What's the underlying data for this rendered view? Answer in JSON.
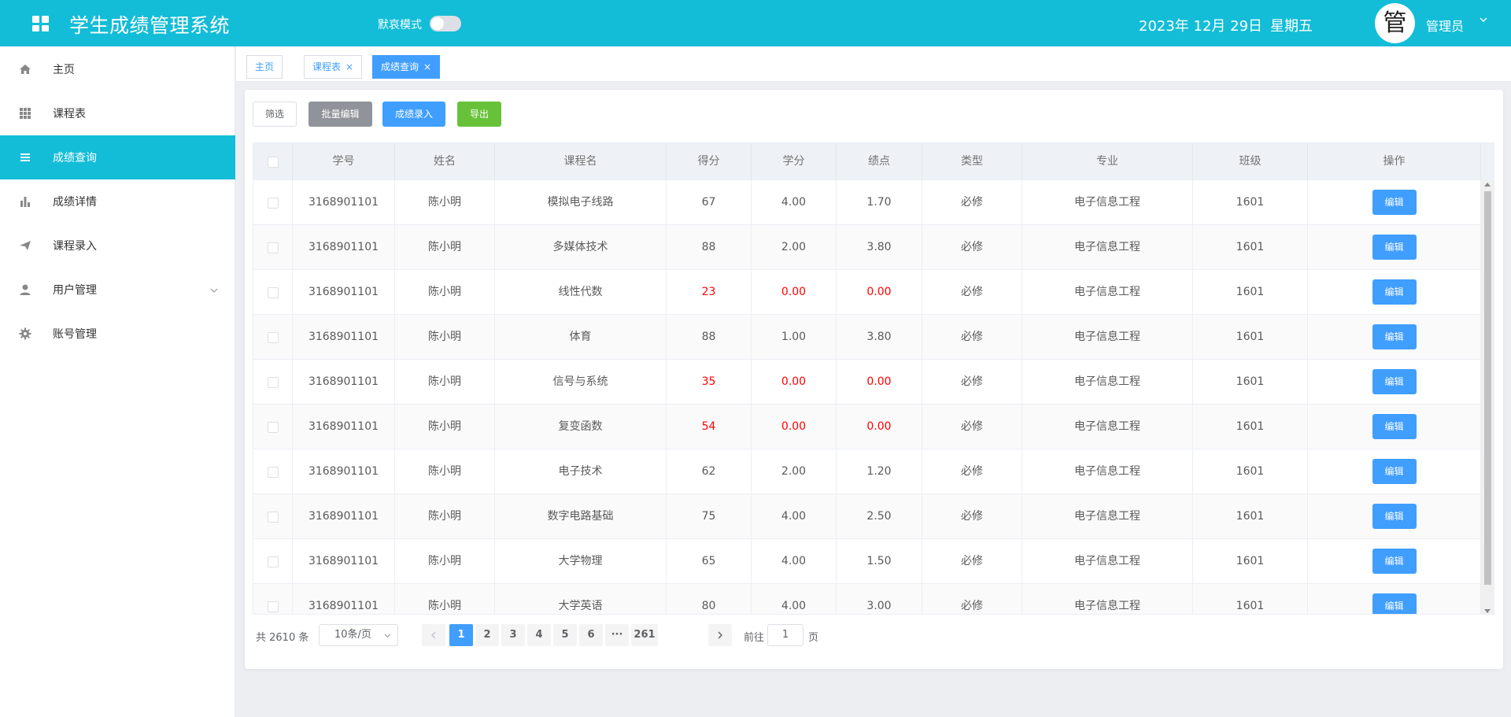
{
  "header": {
    "title": "学生成绩管理系统",
    "dark_mode_label": "默哀模式",
    "dark_mode_on": false,
    "date": "2023年 12月 29日",
    "weekday": "星期五",
    "avatar_char": "管",
    "user_name": "管理员"
  },
  "sidebar": {
    "items": [
      {
        "label": "主页",
        "icon": "home-icon"
      },
      {
        "label": "课程表",
        "icon": "grid-icon"
      },
      {
        "label": "成绩查询",
        "icon": "list-icon",
        "active": true
      },
      {
        "label": "成绩详情",
        "icon": "bar-chart-icon"
      },
      {
        "label": "课程录入",
        "icon": "send-icon"
      },
      {
        "label": "用户管理",
        "icon": "user-icon",
        "expandable": true
      },
      {
        "label": "账号管理",
        "icon": "gear-icon"
      }
    ]
  },
  "tabs": [
    {
      "label": "主页",
      "closable": false
    },
    {
      "label": "课程表",
      "closable": true
    },
    {
      "label": "成绩查询",
      "closable": true,
      "active": true
    }
  ],
  "toolbar": {
    "filter": "筛选",
    "batch_edit": "批量编辑",
    "add_score": "成绩录入",
    "export": "导出"
  },
  "table": {
    "columns": [
      "学号",
      "姓名",
      "课程名",
      "得分",
      "学分",
      "绩点",
      "类型",
      "专业",
      "班级",
      "操作"
    ],
    "edit_label": "编辑",
    "rows": [
      {
        "id": "3168901101",
        "name": "陈小明",
        "course": "模拟电子线路",
        "score": "67",
        "credit": "4.00",
        "gpa": "1.70",
        "type": "必修",
        "major": "电子信息工程",
        "class": "1601",
        "fail": false
      },
      {
        "id": "3168901101",
        "name": "陈小明",
        "course": "多媒体技术",
        "score": "88",
        "credit": "2.00",
        "gpa": "3.80",
        "type": "必修",
        "major": "电子信息工程",
        "class": "1601",
        "fail": false
      },
      {
        "id": "3168901101",
        "name": "陈小明",
        "course": "线性代数",
        "score": "23",
        "credit": "0.00",
        "gpa": "0.00",
        "type": "必修",
        "major": "电子信息工程",
        "class": "1601",
        "fail": true
      },
      {
        "id": "3168901101",
        "name": "陈小明",
        "course": "体育",
        "score": "88",
        "credit": "1.00",
        "gpa": "3.80",
        "type": "必修",
        "major": "电子信息工程",
        "class": "1601",
        "fail": false
      },
      {
        "id": "3168901101",
        "name": "陈小明",
        "course": "信号与系统",
        "score": "35",
        "credit": "0.00",
        "gpa": "0.00",
        "type": "必修",
        "major": "电子信息工程",
        "class": "1601",
        "fail": true
      },
      {
        "id": "3168901101",
        "name": "陈小明",
        "course": "复变函数",
        "score": "54",
        "credit": "0.00",
        "gpa": "0.00",
        "type": "必修",
        "major": "电子信息工程",
        "class": "1601",
        "fail": true
      },
      {
        "id": "3168901101",
        "name": "陈小明",
        "course": "电子技术",
        "score": "62",
        "credit": "2.00",
        "gpa": "1.20",
        "type": "必修",
        "major": "电子信息工程",
        "class": "1601",
        "fail": false
      },
      {
        "id": "3168901101",
        "name": "陈小明",
        "course": "数字电路基础",
        "score": "75",
        "credit": "4.00",
        "gpa": "2.50",
        "type": "必修",
        "major": "电子信息工程",
        "class": "1601",
        "fail": false
      },
      {
        "id": "3168901101",
        "name": "陈小明",
        "course": "大学物理",
        "score": "65",
        "credit": "4.00",
        "gpa": "1.50",
        "type": "必修",
        "major": "电子信息工程",
        "class": "1601",
        "fail": false
      },
      {
        "id": "3168901101",
        "name": "陈小明",
        "course": "大学英语",
        "score": "80",
        "credit": "4.00",
        "gpa": "3.00",
        "type": "必修",
        "major": "电子信息工程",
        "class": "1601",
        "fail": false
      }
    ]
  },
  "pagination": {
    "total": "共 2610 条",
    "page_size": "10条/页",
    "pages": [
      "1",
      "2",
      "3",
      "4",
      "5",
      "6",
      "···",
      "261"
    ],
    "current": "1",
    "goto_label": "前往",
    "goto_value": "1",
    "page_suffix": "页"
  },
  "colors": {
    "accent": "#13bdd7",
    "primary": "#409eff",
    "success": "#67c23a",
    "info": "#909399",
    "fail_text": "#ff0000"
  }
}
